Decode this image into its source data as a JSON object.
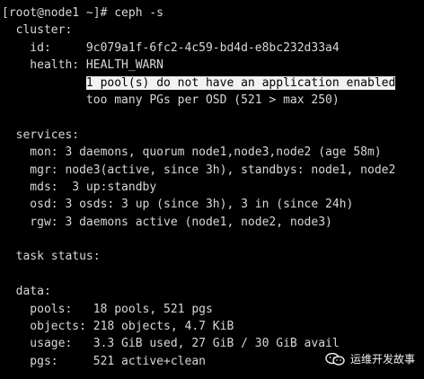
{
  "terminal": {
    "prompt": "[root@node1 ~]# ceph -s",
    "lines": [
      "  cluster:",
      "    id:     9c079a1f-6fc2-4c59-bd4d-e8bc232d33a4",
      "    health: HEALTH_WARN",
      "            1 pool(s) do not have an application enabled",
      "            too many PGs per OSD (521 > max 250)",
      "",
      "  services:",
      "    mon: 3 daemons, quorum node1,node3,node2 (age 58m)",
      "    mgr: node3(active, since 3h), standbys: node1, node2",
      "    mds:  3 up:standby",
      "    osd: 3 osds: 3 up (since 3h), 3 in (since 24h)",
      "    rgw: 3 daemons active (node1, node2, node3)",
      "",
      "  task status:",
      "",
      "  data:",
      "    pools:   18 pools, 521 pgs",
      "    objects: 218 objects, 4.7 KiB",
      "    usage:   3.3 GiB used, 27 GiB / 30 GiB avail",
      "    pgs:     521 active+clean"
    ],
    "highlight_indent": "            ",
    "highlight_text": "1 pool(s) do not have an application enabled"
  },
  "watermark": {
    "text": "运维开发故事",
    "icon": "wechat-icon"
  },
  "colors": {
    "background": "#000000",
    "foreground": "#d8d8d8",
    "highlight_bg": "#f2f2f2",
    "highlight_fg": "#000000"
  }
}
